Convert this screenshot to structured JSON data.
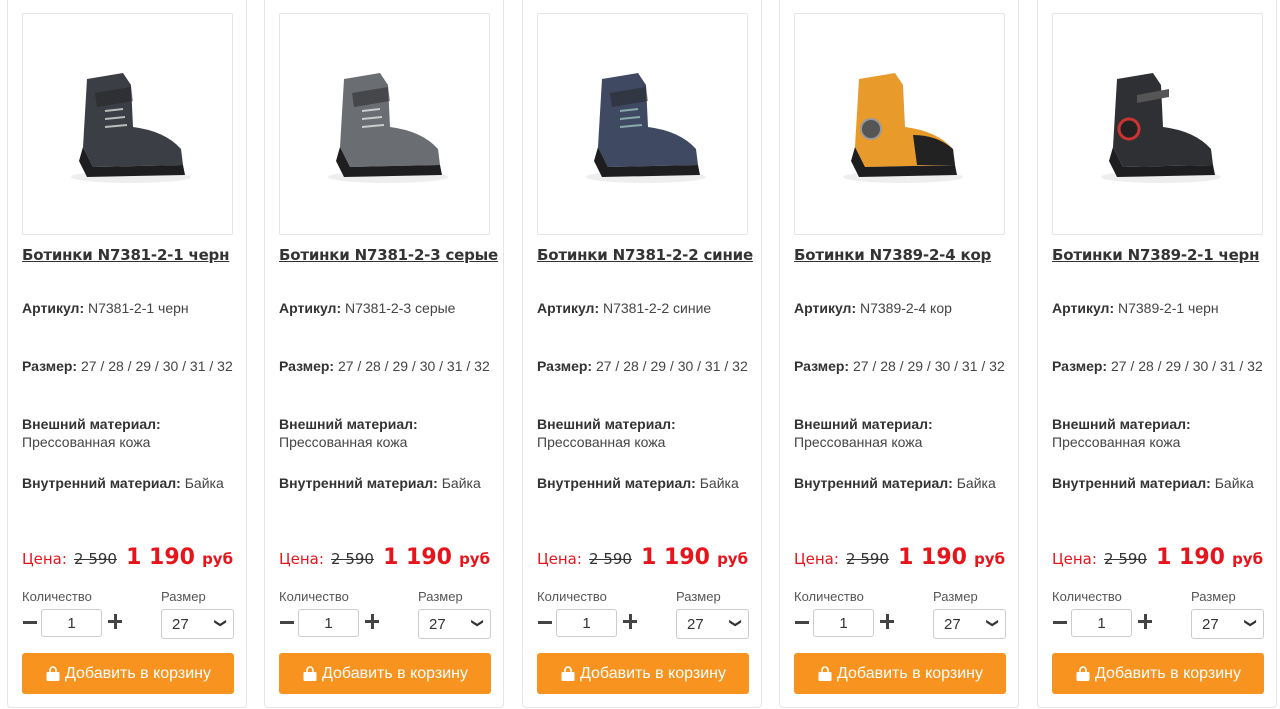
{
  "labels": {
    "article": "Артикул:",
    "size": "Размер:",
    "outer_material": "Внешний материал:",
    "inner_material": "Внутренний материал:",
    "price": "Цена:",
    "currency": "руб",
    "quantity": "Количество",
    "size_select": "Размер",
    "add_to_cart": "Добавить в корзину"
  },
  "products": [
    {
      "title": "Ботинки N7381-2-1 черн",
      "article": "N7381-2-1 черн",
      "sizes": "27 / 28 / 29 / 30 / 31 / 32",
      "outer_material": "Прессованная кожа",
      "inner_material": "Байка",
      "old_price": "2 590",
      "new_price": "1 190",
      "quantity": "1",
      "selected_size": "27",
      "image_icon": "black-boot-icon",
      "boot_color": "#3b3e44"
    },
    {
      "title": "Ботинки N7381-2-3 серые",
      "article": "N7381-2-3 серые",
      "sizes": "27 / 28 / 29 / 30 / 31 / 32",
      "outer_material": "Прессованная кожа",
      "inner_material": "Байка",
      "old_price": "2 590",
      "new_price": "1 190",
      "quantity": "1",
      "selected_size": "27",
      "image_icon": "grey-boot-icon",
      "boot_color": "#6a6d72"
    },
    {
      "title": "Ботинки N7381-2-2 синие",
      "article": "N7381-2-2 синие",
      "sizes": "27 / 28 / 29 / 30 / 31 / 32",
      "outer_material": "Прессованная кожа",
      "inner_material": "Байка",
      "old_price": "2 590",
      "new_price": "1 190",
      "quantity": "1",
      "selected_size": "27",
      "image_icon": "blue-boot-icon",
      "boot_color": "#3f4a62"
    },
    {
      "title": "Ботинки N7389-2-4 кор",
      "article": "N7389-2-4 кор",
      "sizes": "27 / 28 / 29 / 30 / 31 / 32",
      "outer_material": "Прессованная кожа",
      "inner_material": "Байка",
      "old_price": "2 590",
      "new_price": "1 190",
      "quantity": "1",
      "selected_size": "27",
      "image_icon": "orange-boot-icon",
      "boot_color": "#e89a2a"
    },
    {
      "title": "Ботинки N7389-2-1 черн",
      "article": "N7389-2-1 черн",
      "sizes": "27 / 28 / 29 / 30 / 31 / 32",
      "outer_material": "Прессованная кожа",
      "inner_material": "Байка",
      "old_price": "2 590",
      "new_price": "1 190",
      "quantity": "1",
      "selected_size": "27",
      "image_icon": "black-boot-icon",
      "boot_color": "#2f3034"
    }
  ],
  "colors": {
    "accent": "#f7931e",
    "price": "#e8141b"
  }
}
